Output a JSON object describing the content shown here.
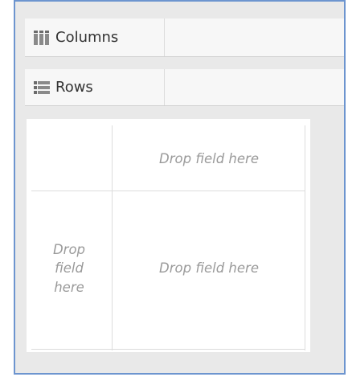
{
  "shelves": {
    "columns": {
      "label": "Columns",
      "icon": "columns-icon"
    },
    "rows": {
      "label": "Rows",
      "icon": "rows-icon"
    }
  },
  "view": {
    "column_drop_text": "Drop field here",
    "row_drop_text": "Drop\nfield\nhere",
    "body_drop_text": "Drop field here"
  },
  "colors": {
    "frame_border": "#6d95cf",
    "icon": "#6b6b6b",
    "placeholder_text": "#9a9a9a"
  }
}
